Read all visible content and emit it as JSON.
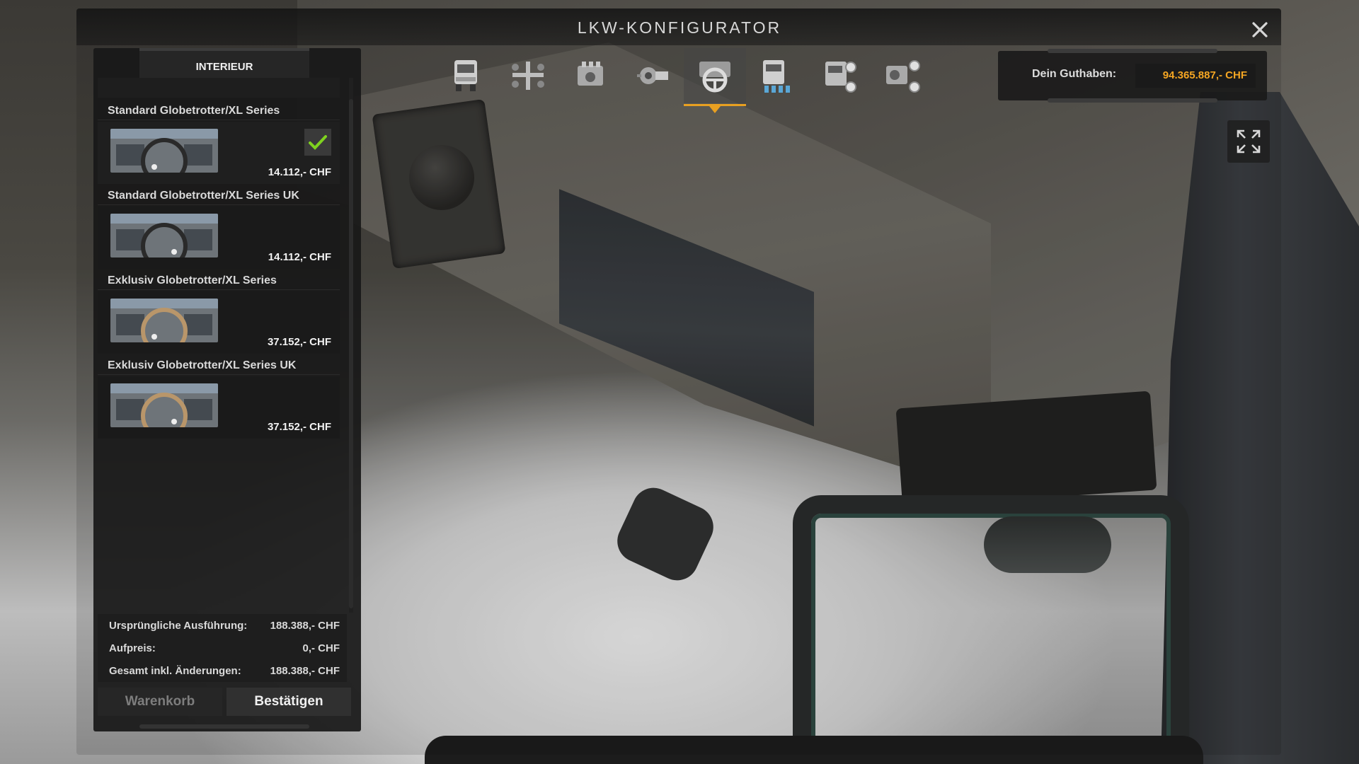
{
  "window": {
    "title": "LKW-KONFIGURATOR"
  },
  "tabs": [
    {
      "id": "chassis",
      "icon": "truck-front-icon",
      "active": false
    },
    {
      "id": "chassis-config",
      "icon": "axle-icon",
      "active": false
    },
    {
      "id": "engine",
      "icon": "engine-icon",
      "active": false
    },
    {
      "id": "transmission",
      "icon": "gearbox-icon",
      "active": false
    },
    {
      "id": "interior",
      "icon": "steering-wheel-icon",
      "active": true
    },
    {
      "id": "cabin",
      "icon": "cabin-icon",
      "active": false
    },
    {
      "id": "chassis-parts",
      "icon": "truck-side-icon",
      "active": false
    },
    {
      "id": "accessories",
      "icon": "parts-icon",
      "active": false
    }
  ],
  "balance": {
    "label": "Dein Guthaben:",
    "value": "94.365.887,- CHF",
    "value_color": "#f5a623"
  },
  "panel": {
    "header": "INTERIEUR",
    "options": [
      {
        "name": "Standard Globetrotter/XL Series",
        "price": "14.112,- CHF",
        "selected": true,
        "wheel": "dark"
      },
      {
        "name": "Standard Globetrotter/XL Series UK",
        "price": "14.112,- CHF",
        "selected": false,
        "wheel": "dark"
      },
      {
        "name": "Exklusiv Globetrotter/XL Series",
        "price": "37.152,- CHF",
        "selected": false,
        "wheel": "wood"
      },
      {
        "name": "Exklusiv Globetrotter/XL Series UK",
        "price": "37.152,- CHF",
        "selected": false,
        "wheel": "wood"
      }
    ],
    "summary": {
      "original_label": "Ursprüngliche Ausführung:",
      "original_value": "188.388,- CHF",
      "surcharge_label": "Aufpreis:",
      "surcharge_value": "0,- CHF",
      "total_label": "Gesamt inkl. Änderungen:",
      "total_value": "188.388,- CHF"
    },
    "buttons": {
      "cart": "Warenkorb",
      "confirm": "Bestätigen"
    }
  },
  "colors": {
    "accent": "#e8a021",
    "check": "#7fd21f"
  }
}
